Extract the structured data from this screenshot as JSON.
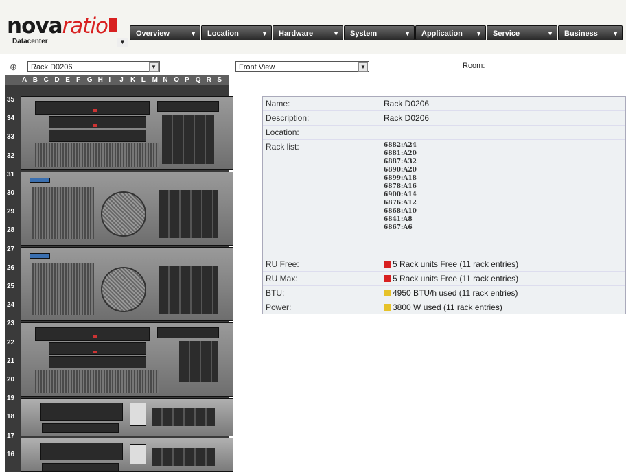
{
  "logo": {
    "part1": "nova",
    "part2": "ratio",
    "subtitle": "Datacenter"
  },
  "nav": [
    {
      "label": "Overview"
    },
    {
      "label": "Location"
    },
    {
      "label": "Hardware"
    },
    {
      "label": "System"
    },
    {
      "label": "Application"
    },
    {
      "label": "Service"
    },
    {
      "label": "Business"
    }
  ],
  "controls": {
    "rack_select": "Rack D0206",
    "view_select": "Front View",
    "room_label": "Room:"
  },
  "rack_columns": [
    "A",
    "B",
    "C",
    "D",
    "E",
    "F",
    "G",
    "H",
    "I",
    "J",
    "K",
    "L",
    "M",
    "N",
    "O",
    "P",
    "Q",
    "R",
    "S"
  ],
  "ru_labels": [
    "35",
    "34",
    "33",
    "32",
    "31",
    "30",
    "29",
    "28",
    "27",
    "26",
    "25",
    "24",
    "23",
    "22",
    "21",
    "20",
    "19",
    "18",
    "17",
    "16"
  ],
  "details": {
    "name_label": "Name:",
    "name_value": "Rack D0206",
    "description_label": "Description:",
    "description_value": "Rack D0206",
    "location_label": "Location:",
    "location_value": "",
    "racklist_label": "Rack list:",
    "racklist": [
      "6882:A24",
      "6881:A20",
      "6887:A32",
      "6890:A20",
      "6899:A18",
      "6878:A16",
      "6900:A14",
      "6876:A12",
      "6868:A10",
      "6841:A8",
      "6867:A6"
    ],
    "rufree_label": "RU Free:",
    "rufree_value": "5 Rack units Free (11 rack entries)",
    "rumax_label": "RU Max:",
    "rumax_value": "5 Rack units Free (11 rack entries)",
    "btu_label": "BTU:",
    "btu_value": "4950 BTU/h used (11 rack entries)",
    "power_label": "Power:",
    "power_value": "3800 W used (11 rack entries)"
  },
  "colors": {
    "red": "#d82020",
    "yellow": "#e6c229"
  }
}
